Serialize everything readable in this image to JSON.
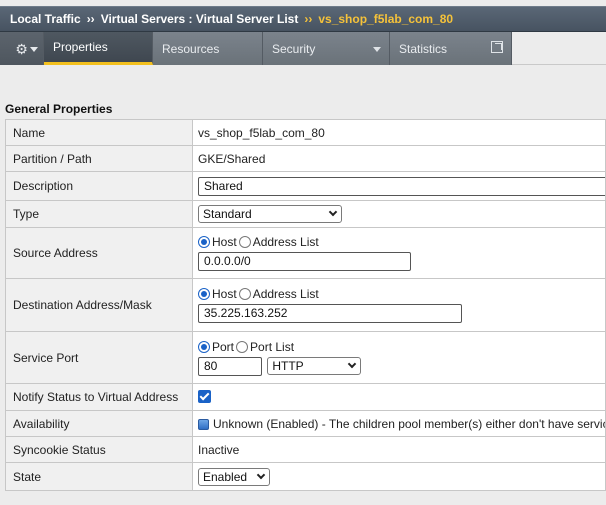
{
  "breadcrumb": {
    "part1": "Local Traffic",
    "sep1": "››",
    "part2": "Virtual Servers : Virtual Server List",
    "sep2": "››",
    "current": "vs_shop_f5lab_com_80"
  },
  "tabs": {
    "gear_icon": "gear-icon",
    "properties": "Properties",
    "resources": "Resources",
    "security": "Security",
    "statistics": "Statistics"
  },
  "section_title": "General Properties",
  "rows": {
    "name": {
      "label": "Name",
      "value": "vs_shop_f5lab_com_80"
    },
    "partition": {
      "label": "Partition / Path",
      "value": "GKE/Shared"
    },
    "description": {
      "label": "Description",
      "value": "Shared"
    },
    "type": {
      "label": "Type",
      "value": "Standard"
    },
    "source": {
      "label": "Source Address",
      "opt_host": "Host",
      "opt_list": "Address List",
      "value": "0.0.0.0/0"
    },
    "destination": {
      "label": "Destination Address/Mask",
      "opt_host": "Host",
      "opt_list": "Address List",
      "value": "35.225.163.252"
    },
    "service_port": {
      "label": "Service Port",
      "opt_port": "Port",
      "opt_list": "Port List",
      "value": "80",
      "protocol": "HTTP"
    },
    "notify": {
      "label": "Notify Status to Virtual Address",
      "checked": true
    },
    "availability": {
      "label": "Availability",
      "value": "Unknown (Enabled) - The children pool member(s) either don't have service checking enabled, or service check results are not available yet"
    },
    "syncookie": {
      "label": "Syncookie Status",
      "value": "Inactive"
    },
    "state": {
      "label": "State",
      "value": "Enabled"
    }
  },
  "colors": {
    "accent": "#f3c01e",
    "header": "#475361",
    "radio_selected": "#1a62c7"
  }
}
